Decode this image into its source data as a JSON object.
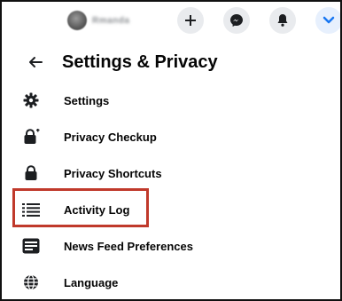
{
  "topbar": {
    "profile_name": "Rmanda",
    "buttons": [
      {
        "icon": "plus-icon"
      },
      {
        "icon": "messenger-icon"
      },
      {
        "icon": "bell-icon"
      },
      {
        "icon": "chevron-down-icon"
      }
    ]
  },
  "header": {
    "title": "Settings & Privacy",
    "back_icon": "arrow-left-icon"
  },
  "menu": {
    "items": [
      {
        "label": "Settings",
        "icon": "gear-icon"
      },
      {
        "label": "Privacy Checkup",
        "icon": "lock-plus-icon"
      },
      {
        "label": "Privacy Shortcuts",
        "icon": "lock-icon"
      },
      {
        "label": "Activity Log",
        "icon": "list-icon",
        "highlighted": true
      },
      {
        "label": "News Feed Preferences",
        "icon": "feed-icon"
      },
      {
        "label": "Language",
        "icon": "globe-icon"
      }
    ]
  },
  "colors": {
    "highlight_border": "#c0392b",
    "accent_blue": "#1877f2",
    "icon_dark": "#1c1e21"
  }
}
